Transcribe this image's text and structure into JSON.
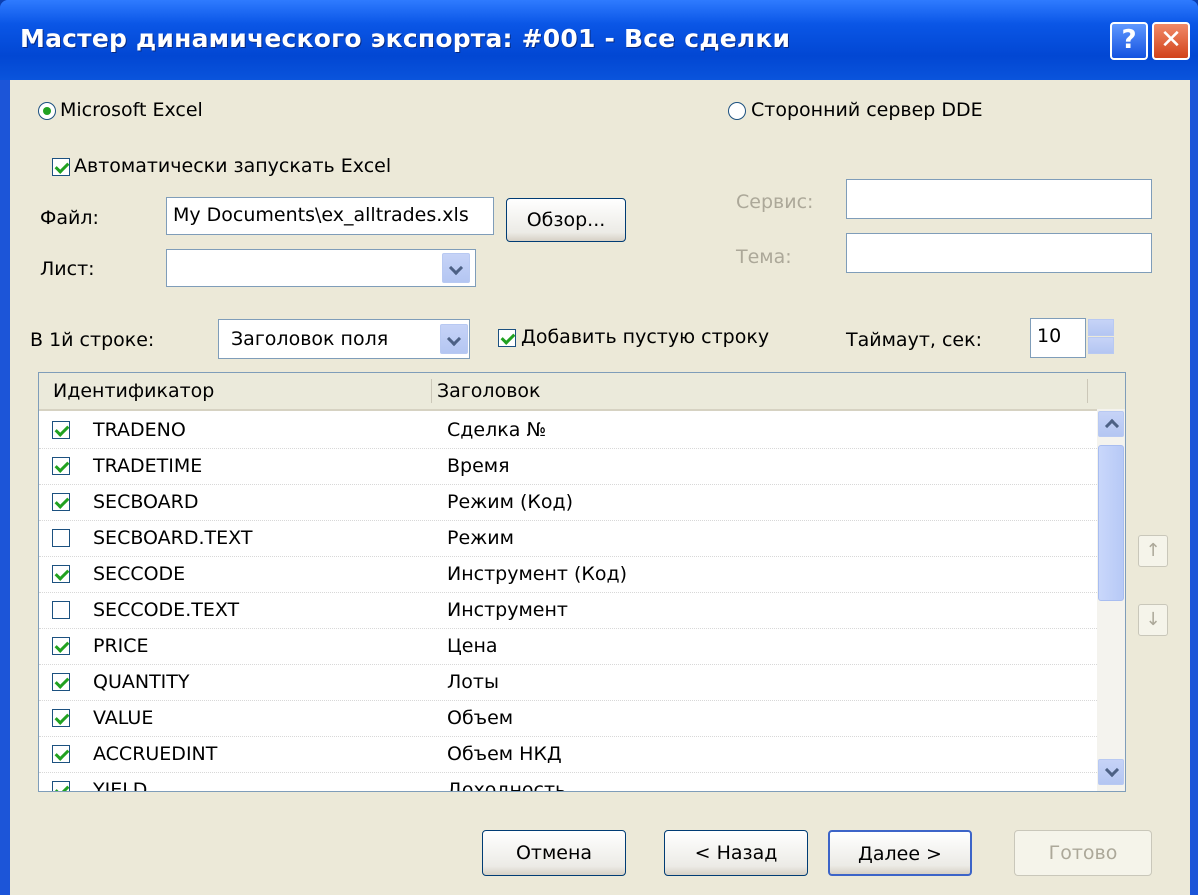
{
  "window": {
    "title": "Мастер динамического экспорта: #001 - Все сделки",
    "help_label": "?",
    "close_label": "✕"
  },
  "target": {
    "excel_label": "Microsoft Excel",
    "excel_selected": true,
    "dde_label": "Сторонний сервер DDE",
    "dde_selected": false
  },
  "excel": {
    "autostart_label": "Автоматически запускать Excel",
    "autostart_checked": true,
    "file_label": "Файл:",
    "file_value": "My Documents\\ex_alltrades.xls",
    "browse_label": "Обзор...",
    "sheet_label": "Лист:",
    "sheet_value": ""
  },
  "dde": {
    "service_label": "Сервис:",
    "service_value": "",
    "topic_label": "Тема:",
    "topic_value": ""
  },
  "options": {
    "first_row_label": "В 1й строке:",
    "first_row_value": "Заголовок поля",
    "add_empty_row_label": "Добавить пустую строку",
    "add_empty_row_checked": true,
    "timeout_label": "Таймаут, сек:",
    "timeout_value": "10"
  },
  "table": {
    "columns": [
      "Идентификатор",
      "Заголовок"
    ],
    "rows": [
      {
        "id": "TRADENO",
        "title": "Сделка №",
        "checked": true
      },
      {
        "id": "TRADETIME",
        "title": "Время",
        "checked": true
      },
      {
        "id": "SECBOARD",
        "title": "Режим (Код)",
        "checked": true
      },
      {
        "id": "SECBOARD.TEXT",
        "title": "Режим",
        "checked": false
      },
      {
        "id": "SECCODE",
        "title": "Инструмент (Код)",
        "checked": true
      },
      {
        "id": "SECCODE.TEXT",
        "title": "Инструмент",
        "checked": false
      },
      {
        "id": "PRICE",
        "title": "Цена",
        "checked": true
      },
      {
        "id": "QUANTITY",
        "title": "Лоты",
        "checked": true
      },
      {
        "id": "VALUE",
        "title": "Объем",
        "checked": true
      },
      {
        "id": "ACCRUEDINT",
        "title": "Объем НКД",
        "checked": true
      },
      {
        "id": "YIELD",
        "title": "Доходность",
        "checked": true
      }
    ]
  },
  "move": {
    "up_label": "↑",
    "down_label": "↓"
  },
  "footer": {
    "cancel_label": "Отмена",
    "back_label": "< Назад",
    "next_label": "Далее >",
    "finish_label": "Готово"
  }
}
